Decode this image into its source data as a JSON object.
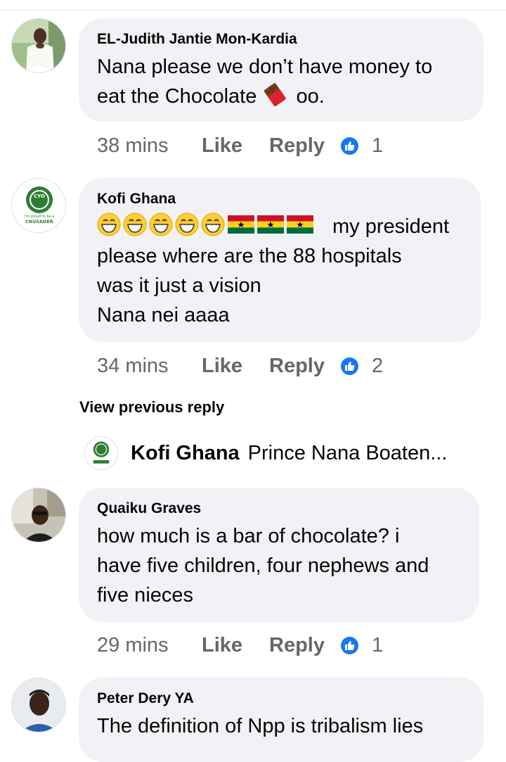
{
  "comments": [
    {
      "author": "EL-Judith Jantie Mon-Kardia",
      "lines": [
        "Nana please we don’t have money to",
        "eat the Chocolate",
        "oo."
      ],
      "time": "38 mins",
      "like_label": "Like",
      "reply_label": "Reply",
      "reactions": "1"
    },
    {
      "author": "Kofi Ghana",
      "lines": [
        "my president",
        "please where are the 88 hospitals",
        "was it just a vision",
        "Nana nei aaaa"
      ],
      "time": "34 mins",
      "like_label": "Like",
      "reply_label": "Reply",
      "reactions": "2"
    },
    {
      "author": "Quaiku Graves",
      "lines": [
        "how much is a bar of chocolate? i",
        "have five children, four nephews and",
        "five nieces"
      ],
      "time": "29 mins",
      "like_label": "Like",
      "reply_label": "Reply",
      "reactions": "1"
    },
    {
      "author": "Peter Dery YA",
      "lines": [
        "The definition of Npp is tribalism lies"
      ]
    }
  ],
  "view_previous_reply": "View previous reply",
  "reply_preview": {
    "author": "Kofi Ghana",
    "text": "Prince Nana Boaten..."
  },
  "logo_badge": {
    "letters": "CYO",
    "line1": "I'm proud to be a",
    "line2": "CRUSADER"
  },
  "colors": {
    "bubble": "#f0f2f5",
    "secondary_text": "#65676b",
    "like_blue": "#1877f2",
    "badge_green": "#2e7d32"
  },
  "icons": [
    "chocolate-emoji",
    "grinning-emoji",
    "ghana-flag-emoji",
    "like-thumb-icon"
  ]
}
